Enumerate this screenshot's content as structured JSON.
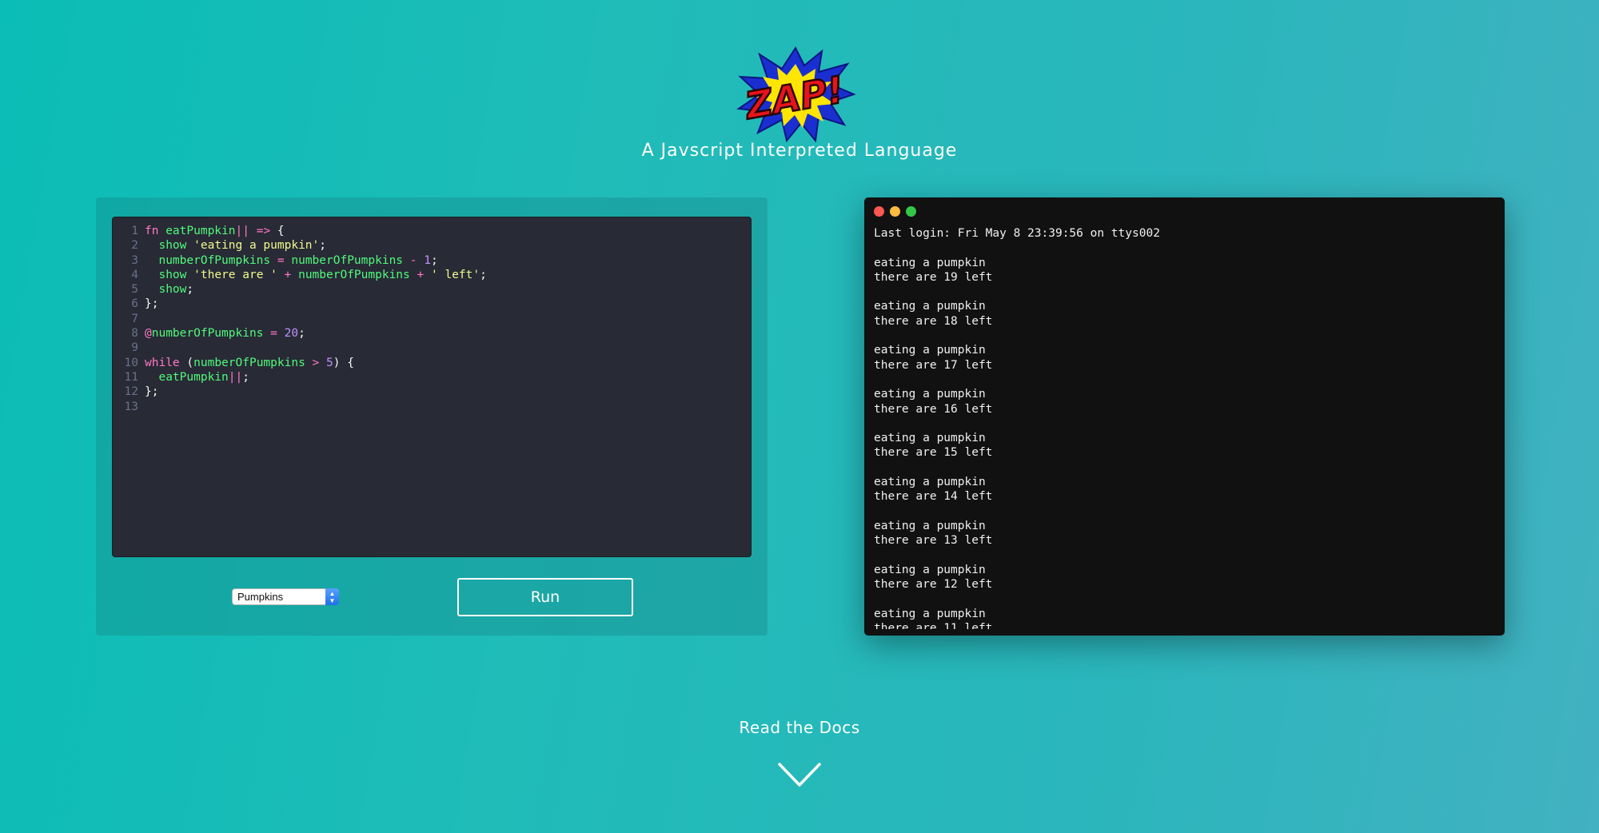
{
  "header": {
    "logo_text": "ZAP!",
    "tagline": "A Javscript Interpreted Language"
  },
  "editor": {
    "lines": [
      {
        "num": "1",
        "tokens": [
          [
            "k",
            "fn "
          ],
          [
            "f",
            "eatPumpkin"
          ],
          [
            "k",
            "||"
          ],
          [
            "p",
            " "
          ],
          [
            "o",
            "=>"
          ],
          [
            "p",
            " {"
          ]
        ]
      },
      {
        "num": "2",
        "tokens": [
          [
            "p",
            "  "
          ],
          [
            "f",
            "show"
          ],
          [
            "p",
            " "
          ],
          [
            "s",
            "'eating a pumpkin'"
          ],
          [
            "p",
            ";"
          ]
        ]
      },
      {
        "num": "3",
        "tokens": [
          [
            "p",
            "  "
          ],
          [
            "f",
            "numberOfPumpkins"
          ],
          [
            "p",
            " "
          ],
          [
            "o",
            "="
          ],
          [
            "p",
            " "
          ],
          [
            "f",
            "numberOfPumpkins"
          ],
          [
            "p",
            " "
          ],
          [
            "o",
            "-"
          ],
          [
            "p",
            " "
          ],
          [
            "n",
            "1"
          ],
          [
            "p",
            ";"
          ]
        ]
      },
      {
        "num": "4",
        "tokens": [
          [
            "p",
            "  "
          ],
          [
            "f",
            "show"
          ],
          [
            "p",
            " "
          ],
          [
            "s",
            "'there are '"
          ],
          [
            "p",
            " "
          ],
          [
            "o",
            "+"
          ],
          [
            "p",
            " "
          ],
          [
            "f",
            "numberOfPumpkins"
          ],
          [
            "p",
            " "
          ],
          [
            "o",
            "+"
          ],
          [
            "p",
            " "
          ],
          [
            "s",
            "' left'"
          ],
          [
            "p",
            ";"
          ]
        ]
      },
      {
        "num": "5",
        "tokens": [
          [
            "p",
            "  "
          ],
          [
            "f",
            "show"
          ],
          [
            "p",
            ";"
          ]
        ]
      },
      {
        "num": "6",
        "tokens": [
          [
            "p",
            "};"
          ]
        ]
      },
      {
        "num": "7",
        "tokens": []
      },
      {
        "num": "8",
        "tokens": [
          [
            "k",
            "@"
          ],
          [
            "f",
            "numberOfPumpkins"
          ],
          [
            "p",
            " "
          ],
          [
            "o",
            "="
          ],
          [
            "p",
            " "
          ],
          [
            "n",
            "20"
          ],
          [
            "p",
            ";"
          ]
        ]
      },
      {
        "num": "9",
        "tokens": []
      },
      {
        "num": "10",
        "tokens": [
          [
            "k",
            "while"
          ],
          [
            "p",
            " ("
          ],
          [
            "f",
            "numberOfPumpkins"
          ],
          [
            "p",
            " "
          ],
          [
            "o",
            ">"
          ],
          [
            "p",
            " "
          ],
          [
            "n",
            "5"
          ],
          [
            "p",
            ") {"
          ]
        ]
      },
      {
        "num": "11",
        "tokens": [
          [
            "p",
            "  "
          ],
          [
            "f",
            "eatPumpkin"
          ],
          [
            "k",
            "||"
          ],
          [
            "p",
            ";"
          ]
        ]
      },
      {
        "num": "12",
        "tokens": [
          [
            "p",
            "};"
          ]
        ]
      },
      {
        "num": "13",
        "tokens": []
      }
    ],
    "example_select": {
      "value": "Pumpkins"
    },
    "run_label": "Run"
  },
  "terminal": {
    "colors": {
      "close": "#fc5753",
      "minimize": "#fdbc40",
      "maximize": "#33c748"
    },
    "lines": [
      "Last login: Fri May 8 23:39:56 on ttys002",
      "",
      "eating a pumpkin",
      "there are 19 left",
      "",
      "eating a pumpkin",
      "there are 18 left",
      "",
      "eating a pumpkin",
      "there are 17 left",
      "",
      "eating a pumpkin",
      "there are 16 left",
      "",
      "eating a pumpkin",
      "there are 15 left",
      "",
      "eating a pumpkin",
      "there are 14 left",
      "",
      "eating a pumpkin",
      "there are 13 left",
      "",
      "eating a pumpkin",
      "there are 12 left",
      "",
      "eating a pumpkin",
      "there are 11 left"
    ]
  },
  "footer": {
    "docs_label": "Read the Docs"
  }
}
